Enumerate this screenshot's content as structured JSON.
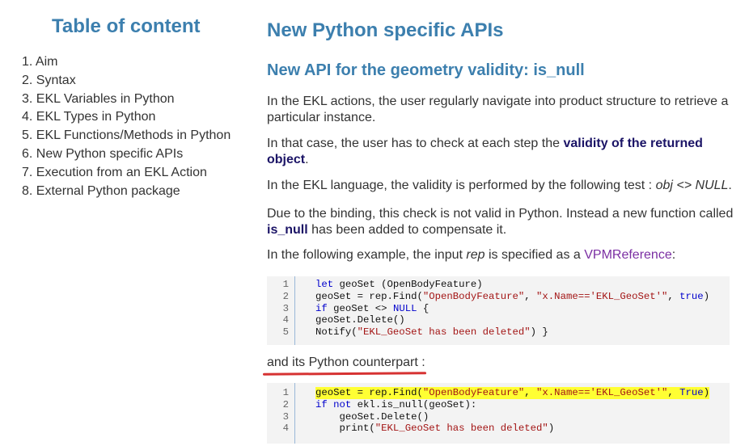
{
  "toc": {
    "title": "Table of content",
    "items": [
      "1. Aim",
      "2. Syntax",
      "3. EKL Variables in Python",
      "4. EKL Types in Python",
      "5. EKL Functions/Methods in Python",
      "6. New Python specific APIs",
      "7. Execution from an EKL Action",
      "8. External Python package"
    ]
  },
  "main": {
    "title": "New Python specific APIs",
    "subtitle": "New API for the geometry validity: is_null",
    "p1": "In the EKL actions, the user regularly navigate into product structure to retrieve a particular instance.",
    "p2_before": "In that case, the user has to check at each step the ",
    "p2_link": "validity of the returned object",
    "p2_after": ".",
    "p3_before": "In the EKL language, the validity is performed by the following test : ",
    "p3_code": "obj <> NULL",
    "p3_after": ".",
    "p4_before": "Due to the binding, this  check is not valid in Python. Instead a new function called ",
    "p4_link": "is_null",
    "p4_after": " has been added to compensate it.",
    "p5_before": "In the following example, the input ",
    "p5_em": "rep",
    "p5_mid": " is specified as a ",
    "p5_link": "VPMReference",
    "p5_after": ":",
    "p6": "and its Python counterpart :"
  },
  "code_ekl": {
    "line_numbers": [
      "1",
      "2",
      "3",
      "4",
      "5"
    ],
    "l1_kw": "let",
    "l1_rest": " geoSet (OpenBodyFeature)",
    "l2_a": "geoSet = rep.Find(",
    "l2_s1": "\"OpenBodyFeature\"",
    "l2_b": ", ",
    "l2_s2": "\"x.Name=='EKL_GeoSet'\"",
    "l2_c": ", ",
    "l2_kw": "true",
    "l2_d": ")",
    "l3_kw": "if",
    "l3_a": " geoSet <> ",
    "l3_kw2": "NULL",
    "l3_b": " {",
    "l4": "geoSet.Delete()",
    "l5_a": "Notify(",
    "l5_s": "\"EKL_GeoSet has been deleted\"",
    "l5_b": ") }"
  },
  "code_py": {
    "line_numbers": [
      "1",
      "2",
      "3",
      "4"
    ],
    "l1_a": "geoSet = rep.Find(",
    "l1_s1": "\"OpenBodyFeature\"",
    "l1_b": ", ",
    "l1_s2": "\"x.Name=='EKL_GeoSet'\"",
    "l1_c": ", ",
    "l1_kw": "True",
    "l1_d": ")",
    "l2_kw": "if",
    "l2_kw2": "not",
    "l2_rest": " ekl.is_null(geoSet):",
    "l3": "    geoSet.Delete()",
    "l4_a": "    print(",
    "l4_s": "\"EKL_GeoSet has been deleted\"",
    "l4_b": ")"
  },
  "colors": {
    "heading": "#3c7fae",
    "strong_link": "#1b1466",
    "link": "#7b2fa3",
    "highlight": "#ffff33",
    "annotation_underline": "#d63232"
  }
}
